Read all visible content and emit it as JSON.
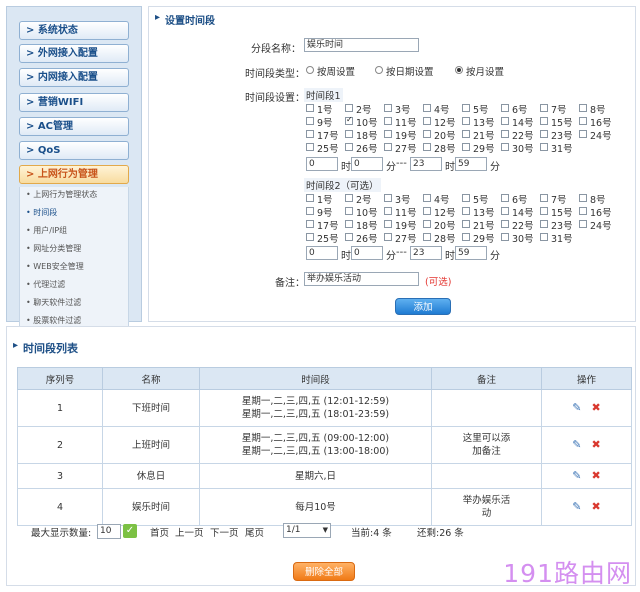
{
  "sidebar": {
    "menus": [
      "> 系统状态",
      "> 外网接入配置",
      "> 内网接入配置",
      "> 营销WIFI",
      "> AC管理",
      "> QoS",
      "> 上网行为管理"
    ],
    "subs": [
      "• 上网行为管理状态",
      "• 时间段",
      "• 用户/IP组",
      "• 网址分类管理",
      "• WEB安全管理",
      "• 代理过滤",
      "• 聊天软件过滤",
      "• 股票软件过滤"
    ]
  },
  "form": {
    "title": "设置时间段",
    "name_label": "分段名称：",
    "name_value": "娱乐时间",
    "type_label": "时间段类型：",
    "type_options": [
      "按周设置",
      "按日期设置",
      "按月设置"
    ],
    "setting_label": "时间段设置：",
    "group1_label": "时间段1",
    "group2_label": "时间段2（可选）",
    "days": [
      "1号",
      "2号",
      "3号",
      "4号",
      "5号",
      "6号",
      "7号",
      "8号",
      "9号",
      "10号",
      "11号",
      "12号",
      "13号",
      "14号",
      "15号",
      "16号",
      "17号",
      "18号",
      "19号",
      "20号",
      "21号",
      "22号",
      "23号",
      "24号",
      "25号",
      "26号",
      "27号",
      "28号",
      "29号",
      "30号",
      "31号"
    ],
    "group1_checked": [
      10
    ],
    "group1_time": {
      "h1": "0",
      "m1": "0",
      "h2": "23",
      "m2": "59"
    },
    "group2_time": {
      "h1": "0",
      "m1": "0",
      "h2": "23",
      "m2": "59"
    },
    "hour_label": "时",
    "minute_label": "分",
    "range_sep": "---",
    "note_label": "备注：",
    "note_value": "举办娱乐活动",
    "optional": "(可选)",
    "add_button": "添加"
  },
  "list": {
    "title": "时间段列表",
    "headers": [
      "序列号",
      "名称",
      "时间段",
      "备注",
      "操作"
    ],
    "rows": [
      {
        "id": "1",
        "name": "下班时间",
        "period": [
          "星期一,二,三,四,五 (12:01-12:59)",
          "星期一,二,三,四,五 (18:01-23:59)"
        ],
        "note": []
      },
      {
        "id": "2",
        "name": "上班时间",
        "period": [
          "星期一,二,三,四,五 (09:00-12:00)",
          "星期一,二,三,四,五 (13:00-18:00)"
        ],
        "note": [
          "这里可以添",
          "加备注"
        ]
      },
      {
        "id": "3",
        "name": "休息日",
        "period": [
          "星期六,日"
        ],
        "note": []
      },
      {
        "id": "4",
        "name": "娱乐时间",
        "period": [
          "每月10号"
        ],
        "note": [
          "举办娱乐活",
          "动"
        ]
      }
    ],
    "max_label": "最大显示数量:",
    "max_value": "10",
    "first": "首页",
    "prev": "上一页",
    "next": "下一页",
    "last": "尾页",
    "page_select": "1/1",
    "current": "当前:4 条",
    "remaining": "还剩:26 条",
    "delete_all": "删除全部"
  },
  "watermark": "191路由网",
  "colors": {
    "accent": "#1f7bd2",
    "delete": "#d9382e",
    "orange": "#f07a17",
    "sidebar_bg": "#dbe7f3"
  }
}
